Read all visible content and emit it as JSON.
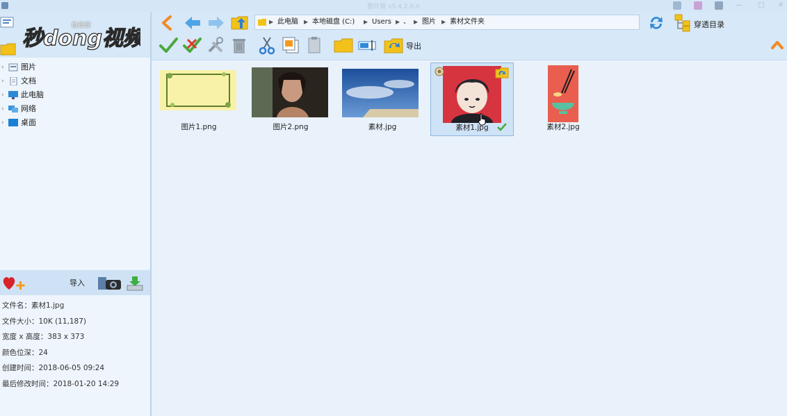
{
  "window": {
    "title": "图片管 v5.4.2.0.0"
  },
  "logo": {
    "text": "秒dong视频",
    "sub": "批处理"
  },
  "tree": {
    "items": [
      {
        "label": "图片",
        "icon": "picture-folder-icon"
      },
      {
        "label": "文档",
        "icon": "document-icon"
      },
      {
        "label": "此电脑",
        "icon": "computer-icon"
      },
      {
        "label": "网络",
        "icon": "network-icon"
      },
      {
        "label": "桌面",
        "icon": "desktop-icon"
      }
    ]
  },
  "import_bar": {
    "label": "导入"
  },
  "properties": {
    "filename": "文件名：素材1.jpg",
    "filesize": "文件大小：10K (11,187)",
    "dimensions": "宽度 x 高度：383 x 373",
    "color_depth": "颜色位深：24",
    "created": "创建时间：2018-06-05 09:24",
    "modified": "最后修改时间：2018-01-20 14:29"
  },
  "address": {
    "crumbs": [
      "此电脑",
      "本地磁盘 (C:)",
      "Users",
      "、",
      "图片",
      "素材文件夹"
    ]
  },
  "through_dir": {
    "label": "穿透目录"
  },
  "toolbar": {
    "export_label": "导出"
  },
  "files": [
    {
      "name": "图片1.png",
      "selected": false
    },
    {
      "name": "图片2.png",
      "selected": false
    },
    {
      "name": "素材.jpg",
      "selected": false
    },
    {
      "name": "素材1.jpg",
      "selected": true
    },
    {
      "name": "素材2.jpg",
      "selected": false
    }
  ],
  "colors": {
    "accent": "#2f7fd1",
    "selection": "#cfe3f7",
    "toolbar": "#d7e8f8"
  }
}
